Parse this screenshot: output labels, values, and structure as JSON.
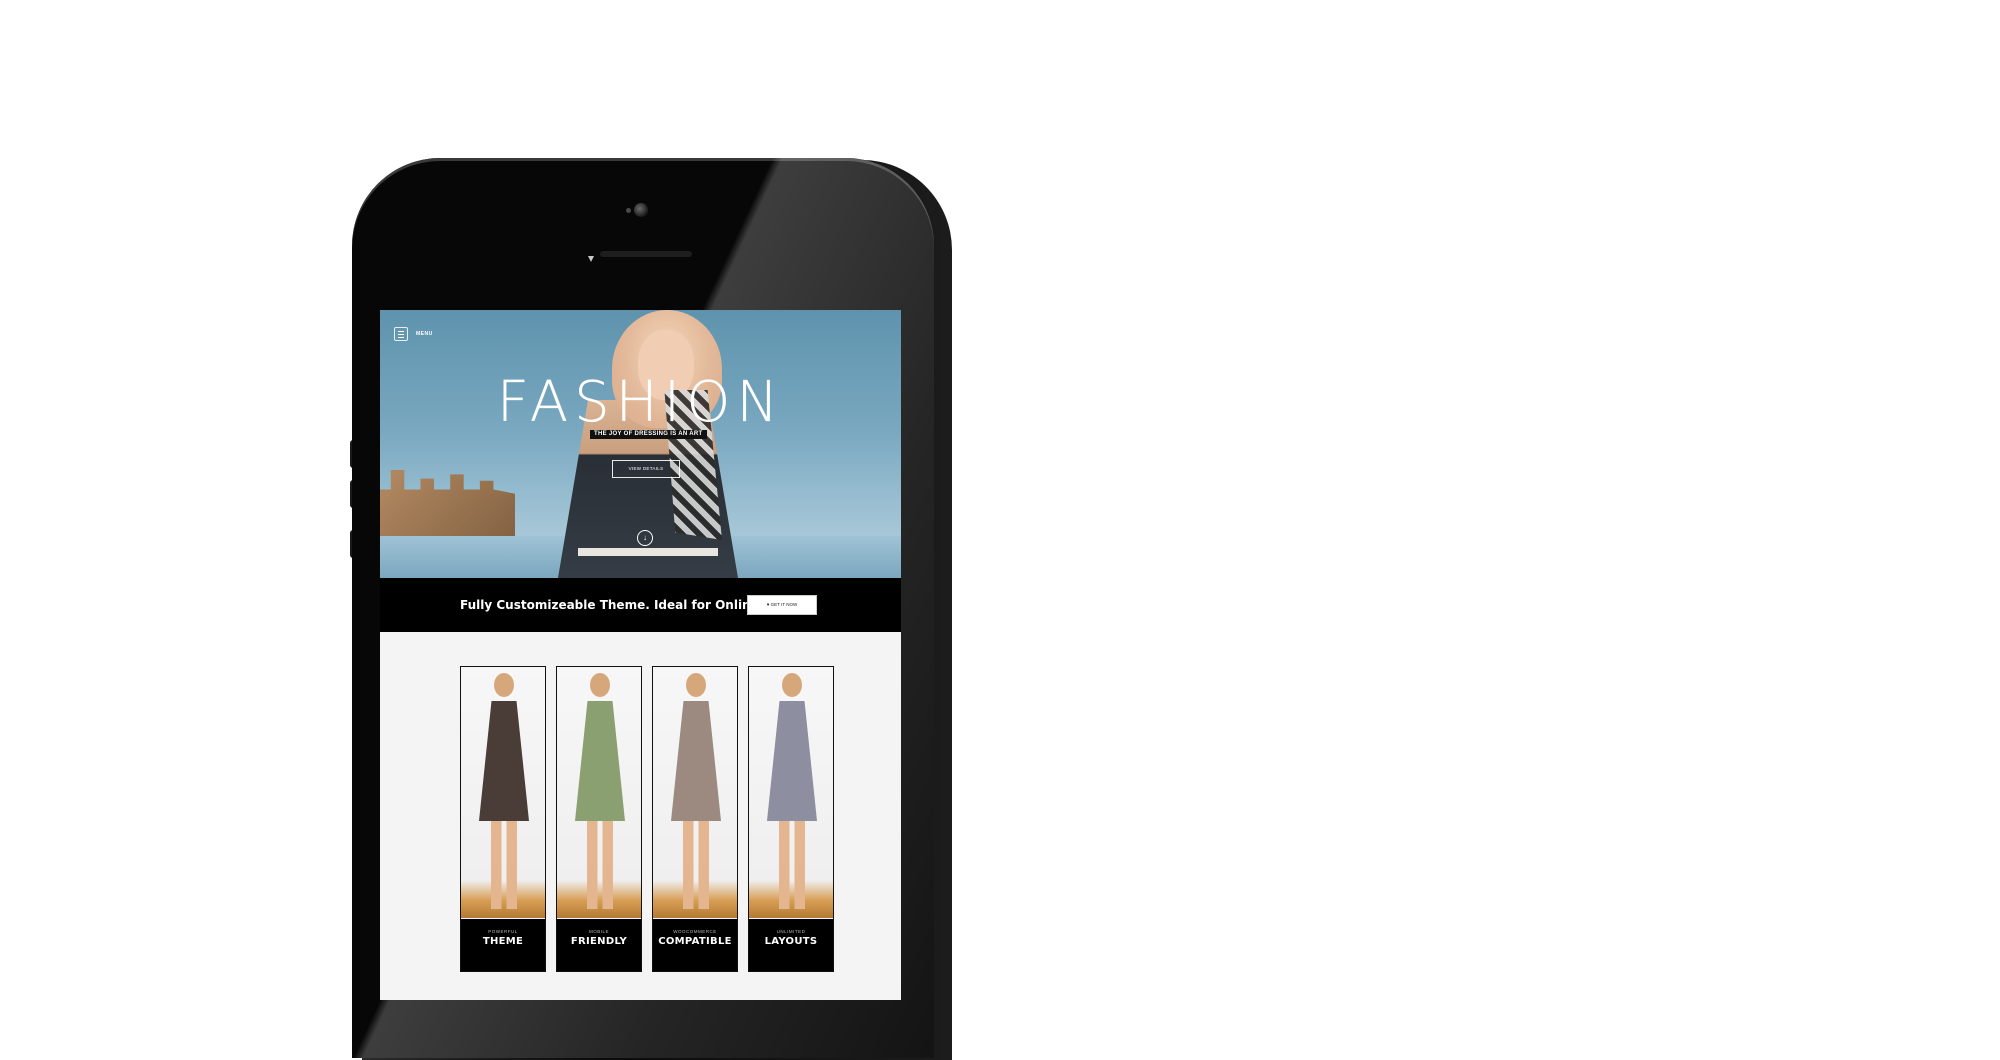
{
  "hero": {
    "menu_label": "MENU",
    "title": "FASHION",
    "tagline": "THE JOY OF DRESSING IS AN ART",
    "details_button": "VIEW DETAILS",
    "scroll_icon": "arrow-down-icon"
  },
  "promo": {
    "text": "Fully Customizeable Theme. Ideal for Online Store!",
    "button_label": "♥ GET IT NOW"
  },
  "features": [
    {
      "small": "POWERFUL",
      "big": "THEME",
      "dress_color": "#4a3d38"
    },
    {
      "small": "MOBILE",
      "big": "FRIENDLY",
      "dress_color": "#8aa071"
    },
    {
      "small": "WOOCOMMERCE",
      "big": "COMPATIBLE",
      "dress_color": "#9c8a80"
    },
    {
      "small": "UNLIMITED",
      "big": "LAYOUTS",
      "dress_color": "#8d8ea0"
    }
  ]
}
